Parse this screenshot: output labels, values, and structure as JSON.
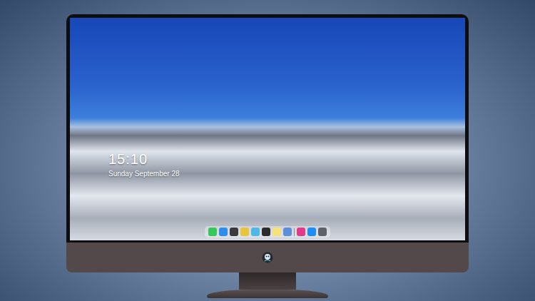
{
  "screen": {
    "clock": {
      "time": "15:10",
      "date": "Sunday September 28"
    }
  },
  "dock": {
    "items": [
      {
        "kind": "app",
        "color": "#34c759"
      },
      {
        "kind": "app",
        "color": "#2f8cf0"
      },
      {
        "kind": "app",
        "color": "#3a3a3c"
      },
      {
        "kind": "app",
        "color": "#e8c53a"
      },
      {
        "kind": "app",
        "color": "#4fb8e8"
      },
      {
        "kind": "app",
        "color": "#2c2c2e"
      },
      {
        "kind": "app",
        "color": "#f6e27a"
      },
      {
        "kind": "app",
        "color": "#5b8fd9"
      },
      {
        "kind": "separator"
      },
      {
        "kind": "app",
        "color": "#e33b8a"
      },
      {
        "kind": "app",
        "color": "#1e8ef7"
      },
      {
        "kind": "app",
        "color": "#5f6368"
      }
    ]
  }
}
